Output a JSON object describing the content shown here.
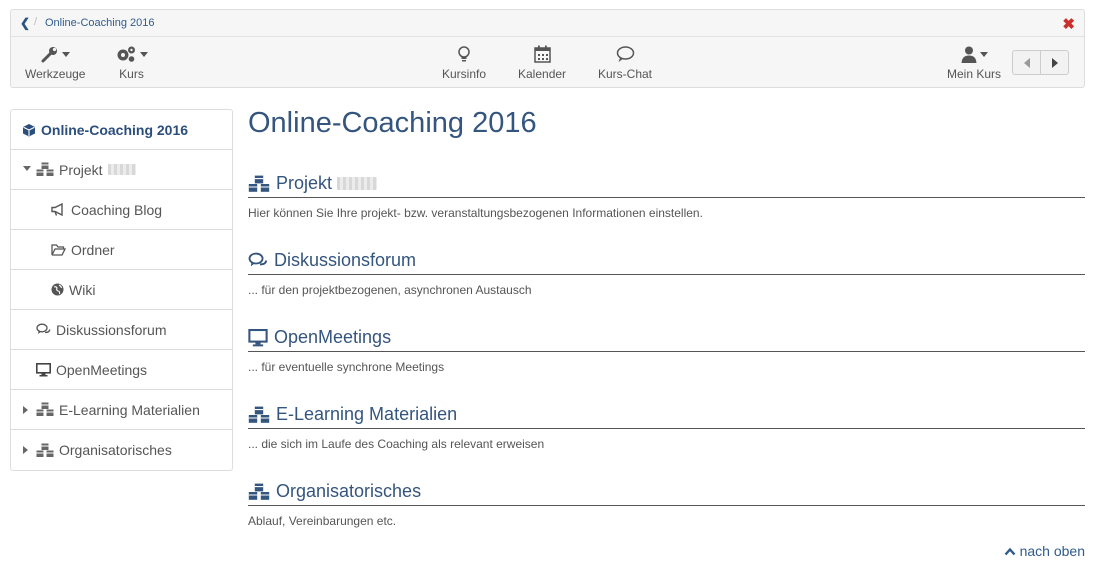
{
  "breadcrumb": {
    "current": "Online-Coaching 2016"
  },
  "toolbar": {
    "tools": [
      {
        "label": "Werkzeuge",
        "icon": "wrench-icon"
      },
      {
        "label": "Kurs",
        "icon": "gears-icon"
      }
    ],
    "center": [
      {
        "label": "Kursinfo",
        "icon": "lightbulb-icon"
      },
      {
        "label": "Kalender",
        "icon": "calendar-icon"
      },
      {
        "label": "Kurs-Chat",
        "icon": "chat-icon"
      }
    ],
    "my_course": {
      "label": "Mein Kurs",
      "icon": "user-icon"
    }
  },
  "sidebar": {
    "items": [
      {
        "label": "Online-Coaching 2016",
        "icon": "cube-icon"
      },
      {
        "label": "Projekt",
        "icon": "cubes-icon"
      },
      {
        "label": "Coaching Blog",
        "icon": "megaphone-icon"
      },
      {
        "label": "Ordner",
        "icon": "folder-icon"
      },
      {
        "label": "Wiki",
        "icon": "globe-icon"
      },
      {
        "label": "Diskussionsforum",
        "icon": "comments-icon"
      },
      {
        "label": "OpenMeetings",
        "icon": "desktop-icon"
      },
      {
        "label": "E-Learning Materialien",
        "icon": "cubes-icon"
      },
      {
        "label": "Organisatorisches",
        "icon": "cubes-icon"
      }
    ]
  },
  "main": {
    "title": "Online-Coaching 2016",
    "sections": [
      {
        "title": "Projekt",
        "icon": "cubes-icon",
        "desc": "Hier können Sie Ihre projekt- bzw. veranstaltungsbezogenen Informationen einstellen."
      },
      {
        "title": "Diskussionsforum",
        "icon": "comments-icon",
        "desc": "... für den projektbezogenen, asynchronen Austausch"
      },
      {
        "title": "OpenMeetings",
        "icon": "desktop-icon",
        "desc": "... für eventuelle synchrone Meetings"
      },
      {
        "title": "E-Learning Materialien",
        "icon": "cubes-icon",
        "desc": "... die sich im Laufe des Coaching als relevant erweisen"
      },
      {
        "title": "Organisatorisches",
        "icon": "cubes-icon",
        "desc": "Ablauf, Vereinbarungen etc."
      }
    ],
    "to_top": "nach oben"
  },
  "colors": {
    "accent": "#34557e",
    "close": "#c9302c",
    "link": "#2f5b8c"
  }
}
